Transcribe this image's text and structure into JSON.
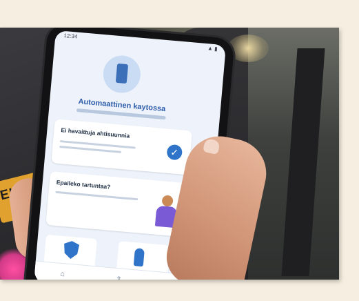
{
  "screen": {
    "status_time": "12:34",
    "hero_title": "Automaattinen kaytossa",
    "card1": {
      "title": "Ei havaittuja ahtisuunnia"
    },
    "card2": {
      "title": "Epaileko tartuntaa?"
    },
    "nav": {
      "home_icon": "home-icon",
      "share_icon": "share-icon",
      "settings_icon": "gear-icon"
    }
  },
  "shirt_text": "ELAS"
}
